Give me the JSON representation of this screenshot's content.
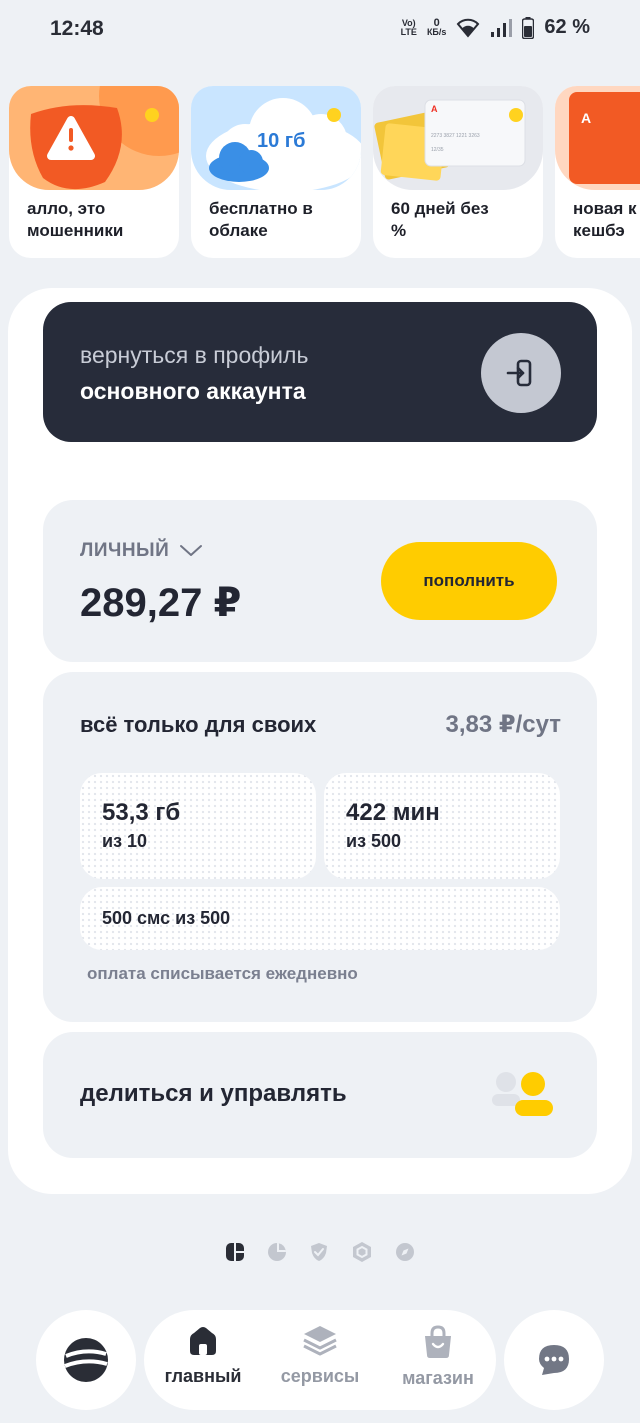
{
  "status_bar": {
    "time": "12:48",
    "volte_line1": "Vo)",
    "volte_line2": "LTE",
    "speed_value": "0",
    "speed_unit": "КБ/s",
    "battery": "62 %"
  },
  "stories": [
    {
      "text": "алло, это\nмошенники",
      "art": "warning-shield"
    },
    {
      "text": "бесплатно в\nоблаке",
      "art": "cloud",
      "badge": "10 гб"
    },
    {
      "text": "60 дней без\n%",
      "art": "credit-card",
      "card_brand": "А",
      "card_number": "2273 3827 1221 3263",
      "card_expiry": "12/35"
    },
    {
      "text": "новая к\nкешбэ",
      "art": "alfa-card",
      "card_brand": "А"
    }
  ],
  "back_to_profile": {
    "line1": "вернуться в профиль",
    "line2": "основного аккаунта"
  },
  "balance": {
    "label": "ЛИЧНЫЙ",
    "amount": "289,27 ₽",
    "topup_label": "пополнить"
  },
  "tariff": {
    "name": "всё только для своих",
    "price": "3,83 ₽/сут",
    "internet": {
      "value": "53,3 гб",
      "sub": "из 10"
    },
    "minutes": {
      "value": "422 мин",
      "sub": "из 500"
    },
    "sms": "500 смс из 500",
    "note": "оплата списывается ежедневно"
  },
  "share": {
    "label": "делиться и управлять"
  },
  "pager": {
    "pages": 5,
    "active": 0
  },
  "nav": {
    "home": "главный",
    "services": "сервисы",
    "shop": "магазин"
  },
  "colors": {
    "accent": "#ffcc00",
    "dark_card": "#272c3a",
    "background": "#eef1f5",
    "muted_text": "#707585"
  }
}
